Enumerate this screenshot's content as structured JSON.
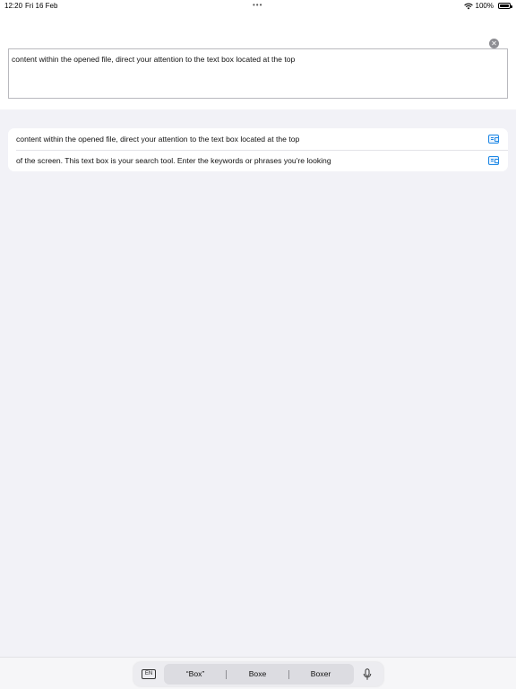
{
  "status_bar": {
    "time": "12:20",
    "date": "Fri 16 Feb",
    "dots": "•••",
    "battery": "100%"
  },
  "search": {
    "value": "content within the opened file, direct your attention to the text box located at the top",
    "clear_icon": "close-circle-icon"
  },
  "results": [
    {
      "text": "content within the opened file, direct your attention to the text box located at the top",
      "icon": "document-icon"
    },
    {
      "text": "of the screen. This text box is your search tool. Enter the keywords or phrases you're looking",
      "icon": "document-icon"
    }
  ],
  "keyboard": {
    "language": "EN",
    "suggestions": [
      "“Box”",
      "Boxe",
      "Boxer"
    ],
    "mic_icon": "microphone-icon"
  },
  "colors": {
    "background": "#f2f2f7",
    "accent": "#1e88e5"
  }
}
